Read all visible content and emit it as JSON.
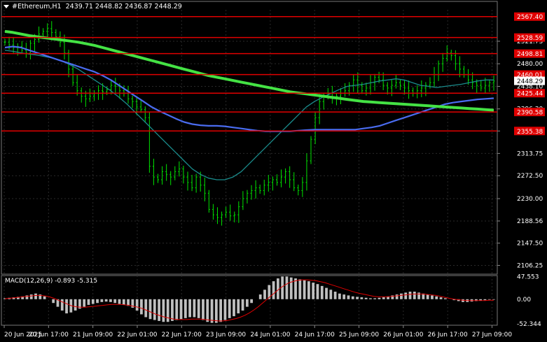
{
  "header": {
    "symbol": "#Ethereum,H1",
    "ohlc": "2439.71 2448.82 2436.87 2448.29"
  },
  "colors": {
    "background": "#000000",
    "grid": "#2a2a2a",
    "candle": "#00e400",
    "level_line": "#e00000",
    "level_label_bg": "#e00000",
    "ma_fast": "#1a8c8c",
    "ma_mid": "#4a6cf0",
    "ma_slow": "#44e244",
    "macd_hist": "#c0c0c0",
    "macd_signal": "#e00000",
    "price_tag_bg": "#ffffff"
  },
  "chart_data": [
    {
      "type": "line",
      "title": "#Ethereum,H1",
      "current_price": "2448.29",
      "y_ticks": [
        "2521.73",
        "2480.00",
        "2438.10",
        "2396.30",
        "2355.38",
        "2313.75",
        "2272.50",
        "2230.00",
        "2188.56",
        "2147.50",
        "2106.25"
      ],
      "ylim": [
        2090,
        2580
      ],
      "x_ticks": [
        "20 Jun 2025",
        "20 Jun 17:00",
        "21 Jun 09:00",
        "22 Jun 01:00",
        "22 Jun 17:00",
        "23 Jun 09:00",
        "24 Jun 01:00",
        "24 Jun 17:00",
        "25 Jun 09:00",
        "26 Jun 01:00",
        "26 Jun 17:00",
        "27 Jun 09:00"
      ],
      "levels": [
        {
          "label": "2567.40",
          "value": 2567.4
        },
        {
          "label": "2528.59",
          "value": 2528.59
        },
        {
          "label": "2498.81",
          "value": 2498.81
        },
        {
          "label": "2460.01",
          "value": 2460.01
        },
        {
          "label": "2425.44",
          "value": 2425.44
        },
        {
          "label": "2390.58",
          "value": 2390.58
        },
        {
          "label": "2355.38",
          "value": 2355.38
        }
      ],
      "price_close_series": [
        2520,
        2515,
        2510,
        2512,
        2505,
        2500,
        2518,
        2525,
        2535,
        2540,
        2545,
        2538,
        2530,
        2520,
        2500,
        2470,
        2445,
        2430,
        2420,
        2415,
        2420,
        2425,
        2430,
        2428,
        2432,
        2440,
        2438,
        2430,
        2425,
        2415,
        2410,
        2400,
        2395,
        2380,
        2290,
        2270,
        2265,
        2280,
        2275,
        2270,
        2280,
        2285,
        2270,
        2260,
        2250,
        2270,
        2255,
        2240,
        2210,
        2200,
        2195,
        2200,
        2205,
        2198,
        2200,
        2215,
        2230,
        2240,
        2245,
        2250,
        2245,
        2255,
        2260,
        2265,
        2260,
        2270,
        2280,
        2265,
        2250,
        2245,
        2260,
        2300,
        2340,
        2380,
        2410,
        2420,
        2425,
        2415,
        2420,
        2425,
        2430,
        2440,
        2450,
        2440,
        2430,
        2435,
        2445,
        2455,
        2450,
        2440,
        2435,
        2440,
        2445,
        2440,
        2435,
        2430,
        2425,
        2430,
        2435,
        2440,
        2445,
        2460,
        2480,
        2490,
        2500,
        2495,
        2480,
        2470,
        2460,
        2450,
        2445,
        2440,
        2435,
        2440,
        2445,
        2448
      ],
      "series": [
        {
          "name": "fast MA",
          "values": [
            2505,
            2503,
            2500,
            2498,
            2496,
            2493,
            2490,
            2485,
            2478,
            2470,
            2460,
            2450,
            2440,
            2430,
            2418,
            2405,
            2390,
            2375,
            2360,
            2345,
            2330,
            2315,
            2300,
            2285,
            2275,
            2268,
            2265,
            2265,
            2270,
            2280,
            2295,
            2310,
            2325,
            2340,
            2355,
            2370,
            2385,
            2400,
            2410,
            2418,
            2425,
            2432,
            2438,
            2440,
            2442,
            2445,
            2448,
            2450,
            2452,
            2450,
            2445,
            2440,
            2438,
            2436,
            2438,
            2440,
            2442,
            2445,
            2448,
            2450,
            2450
          ]
        },
        {
          "name": "mid MA",
          "values": [
            2510,
            2512,
            2510,
            2505,
            2500,
            2495,
            2490,
            2485,
            2480,
            2475,
            2470,
            2465,
            2458,
            2450,
            2440,
            2430,
            2420,
            2410,
            2400,
            2392,
            2385,
            2378,
            2372,
            2368,
            2366,
            2365,
            2365,
            2364,
            2362,
            2360,
            2358,
            2356,
            2355,
            2355,
            2355,
            2355,
            2356,
            2357,
            2358,
            2358,
            2358,
            2358,
            2358,
            2358,
            2360,
            2362,
            2365,
            2370,
            2375,
            2380,
            2385,
            2390,
            2395,
            2400,
            2405,
            2408,
            2410,
            2412,
            2414,
            2415,
            2416
          ]
        },
        {
          "name": "slow MA",
          "values": [
            2540,
            2538,
            2535,
            2532,
            2530,
            2528,
            2526,
            2524,
            2522,
            2520,
            2517,
            2514,
            2510,
            2506,
            2502,
            2498,
            2494,
            2490,
            2486,
            2482,
            2478,
            2474,
            2470,
            2466,
            2462,
            2458,
            2455,
            2452,
            2449,
            2446,
            2443,
            2440,
            2437,
            2434,
            2431,
            2428,
            2426,
            2424,
            2422,
            2420,
            2418,
            2416,
            2414,
            2412,
            2410,
            2409,
            2408,
            2407,
            2406,
            2405,
            2404,
            2403,
            2402,
            2401,
            2400,
            2399,
            2398,
            2397,
            2396,
            2395,
            2394
          ]
        }
      ]
    },
    {
      "type": "bar",
      "title": "MACD(12,26,9) -0.893 -5.315",
      "y_ticks": [
        "47.553",
        "0.00",
        "-52.344"
      ],
      "ylim": [
        -55,
        50
      ],
      "histogram": [
        2,
        3,
        4,
        5,
        6,
        8,
        10,
        12,
        10,
        6,
        0,
        -8,
        -16,
        -24,
        -30,
        -28,
        -24,
        -20,
        -16,
        -12,
        -10,
        -8,
        -6,
        -5,
        -6,
        -8,
        -10,
        -12,
        -14,
        -18,
        -24,
        -32,
        -38,
        -42,
        -44,
        -46,
        -48,
        -48,
        -46,
        -44,
        -42,
        -40,
        -38,
        -38,
        -40,
        -44,
        -48,
        -50,
        -50,
        -48,
        -44,
        -40,
        -36,
        -30,
        -24,
        -16,
        -8,
        0,
        10,
        20,
        30,
        38,
        44,
        48,
        48,
        46,
        44,
        42,
        40,
        38,
        35,
        32,
        28,
        24,
        20,
        16,
        12,
        10,
        8,
        6,
        5,
        4,
        3,
        2,
        2,
        3,
        4,
        6,
        8,
        10,
        12,
        14,
        16,
        16,
        14,
        12,
        10,
        8,
        6,
        4,
        2,
        0,
        -2,
        -4,
        -6,
        -6,
        -5,
        -4,
        -3,
        -2,
        -1,
        -1
      ],
      "signal": [
        1,
        2,
        3,
        4,
        5,
        6,
        7,
        8,
        8,
        7,
        5,
        2,
        -2,
        -6,
        -10,
        -14,
        -16,
        -17,
        -17,
        -16,
        -15,
        -14,
        -13,
        -12,
        -11,
        -11,
        -11,
        -12,
        -13,
        -15,
        -17,
        -20,
        -24,
        -28,
        -32,
        -35,
        -38,
        -40,
        -42,
        -43,
        -43,
        -43,
        -42,
        -42,
        -42,
        -43,
        -44,
        -45,
        -46,
        -46,
        -45,
        -43,
        -41,
        -38,
        -34,
        -29,
        -23,
        -16,
        -8,
        0,
        8,
        16,
        24,
        30,
        35,
        38,
        40,
        41,
        41,
        40,
        39,
        37,
        35,
        32,
        29,
        26,
        23,
        20,
        17,
        14,
        12,
        10,
        8,
        6,
        5,
        5,
        5,
        6,
        7,
        8,
        9,
        10,
        11,
        11,
        11,
        10,
        9,
        8,
        6,
        4,
        2,
        0,
        -1,
        -2,
        -3,
        -3,
        -3,
        -3,
        -3,
        -2,
        -2
      ]
    }
  ]
}
